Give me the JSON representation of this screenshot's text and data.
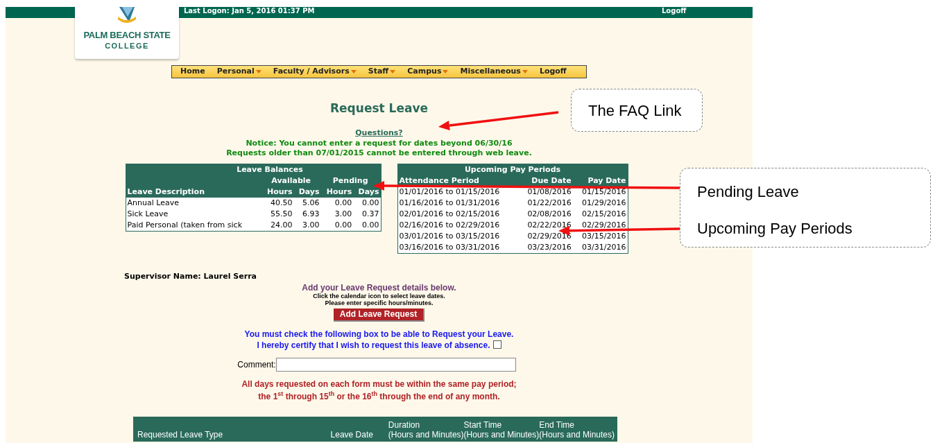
{
  "header": {
    "last_logon": "Last Logon: Jan 5, 2016 01:37 PM",
    "logoff": "Logoff"
  },
  "logo": {
    "lines": [
      "PALM BEACH STATE",
      "COLLEGE"
    ]
  },
  "menu": [
    {
      "label": "Home",
      "has_dropdown": false
    },
    {
      "label": "Personal",
      "has_dropdown": true
    },
    {
      "label": "Faculty / Advisors",
      "has_dropdown": true
    },
    {
      "label": "Staff",
      "has_dropdown": true
    },
    {
      "label": "Campus",
      "has_dropdown": true
    },
    {
      "label": "Miscellaneous",
      "has_dropdown": true
    },
    {
      "label": "Logoff",
      "has_dropdown": false
    }
  ],
  "title": "Request Leave",
  "questions_link": "Questions?",
  "notices": [
    "Notice: You cannot enter a request for dates beyond 06/30/16",
    "Requests older than 07/01/2015 cannot be entered through web leave."
  ],
  "leave_balances": {
    "title": "Leave Balances",
    "group_headers": [
      "Available",
      "Pending"
    ],
    "columns": [
      "Leave Description",
      "Hours",
      "Days",
      "Hours",
      "Days"
    ],
    "rows": [
      [
        "Annual Leave",
        "40.50",
        "5.06",
        "0.00",
        "0.00"
      ],
      [
        "Sick Leave",
        "55.50",
        "6.93",
        "3.00",
        "0.37"
      ],
      [
        "Paid Personal (taken from sick",
        "24.00",
        "3.00",
        "0.00",
        "0.00"
      ]
    ]
  },
  "pay_periods": {
    "title": "Upcoming Pay Periods",
    "columns": [
      "Attendance Period",
      "Due Date",
      "Pay Date"
    ],
    "rows": [
      [
        "01/01/2016 to 01/15/2016",
        "01/08/2016",
        "01/15/2016"
      ],
      [
        "01/16/2016 to 01/31/2016",
        "01/22/2016",
        "01/29/2016"
      ],
      [
        "02/01/2016 to 02/15/2016",
        "02/08/2016",
        "02/15/2016"
      ],
      [
        "02/16/2016 to 02/29/2016",
        "02/22/2016",
        "02/29/2016"
      ],
      [
        "03/01/2016 to 03/15/2016",
        "02/29/2016",
        "03/15/2016"
      ],
      [
        "03/16/2016 to 03/31/2016",
        "03/23/2016",
        "03/31/2016"
      ]
    ]
  },
  "supervisor": "Supervisor Name: Laurel Serra",
  "instructions": {
    "heading": "Add your Leave Request details below.",
    "lines": [
      "Click the calendar icon to select leave dates.",
      "Please enter specific hours/minutes."
    ]
  },
  "add_button": "Add Leave Request",
  "certify": {
    "notice": "You must check the following box to be able to Request your Leave.",
    "label": "I hereby certify that I wish to request this leave of absence.",
    "checked": false
  },
  "comment": {
    "label": "Comment:"
  },
  "pay_period_rule": [
    "All days requested on each form must be within the same pay period;",
    "the 1$^{st}$ through 15$^{th}$ or the 16$^{th}$ through the end of any month."
  ],
  "request_table": {
    "columns": [
      {
        "lines": [
          "Requested Leave Type"
        ]
      },
      {
        "lines": [
          "Leave Date"
        ]
      },
      {
        "lines": [
          "Duration",
          "(Hours and Minutes)"
        ]
      },
      {
        "lines": [
          "Start Time",
          "(Hours and Minutes)"
        ]
      },
      {
        "lines": [
          "End Time",
          "(Hours and Minutes)"
        ]
      }
    ]
  },
  "annotations": [
    {
      "texts": [
        "The FAQ Link"
      ]
    },
    {
      "texts": [
        "Pending Leave",
        "Upcoming Pay Periods"
      ]
    }
  ]
}
